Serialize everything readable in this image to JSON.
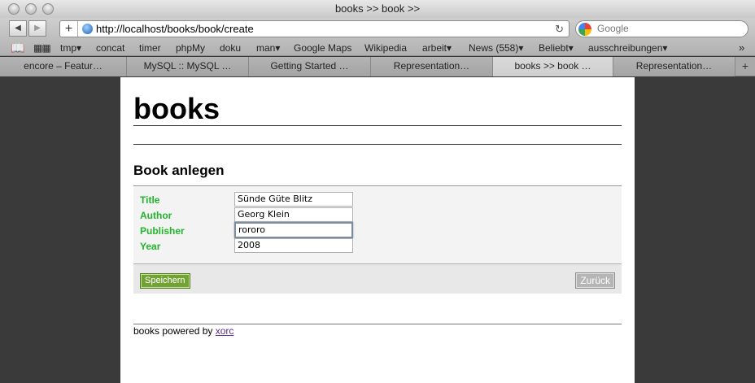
{
  "window": {
    "title": "books >> book >>"
  },
  "toolbar": {
    "back_icon": "back-arrow-icon",
    "forward_icon": "forward-arrow-icon",
    "add_icon": "plus-icon",
    "url": "http://localhost/books/book/create",
    "search_placeholder": "Google"
  },
  "bookmarks": {
    "items": [
      {
        "label": "tmp",
        "dropdown": true
      },
      {
        "label": "concat",
        "dropdown": false
      },
      {
        "label": "timer",
        "dropdown": false
      },
      {
        "label": "phpMy",
        "dropdown": false
      },
      {
        "label": "doku",
        "dropdown": false
      },
      {
        "label": "man",
        "dropdown": true
      },
      {
        "label": "Google Maps",
        "dropdown": false
      },
      {
        "label": "Wikipedia",
        "dropdown": false
      },
      {
        "label": "arbeit",
        "dropdown": true
      },
      {
        "label": "News (558)",
        "dropdown": true
      },
      {
        "label": "Beliebt",
        "dropdown": true
      },
      {
        "label": "ausschreibungen",
        "dropdown": true
      }
    ],
    "overflow": "»"
  },
  "tabs": [
    {
      "label": "encore – Featur…",
      "active": false
    },
    {
      "label": "MySQL :: MySQL …",
      "active": false
    },
    {
      "label": "Getting Started …",
      "active": false
    },
    {
      "label": "Representation…",
      "active": false
    },
    {
      "label": "books >> book …",
      "active": true
    },
    {
      "label": "Representation…",
      "active": false
    }
  ],
  "page": {
    "site_title": "books",
    "form_title": "Book anlegen",
    "fields": [
      {
        "label": "Title",
        "value": "Sünde Güte Blitz"
      },
      {
        "label": "Author",
        "value": "Georg Klein"
      },
      {
        "label": "Publisher",
        "value": "rororo"
      },
      {
        "label": "Year",
        "value": "2008"
      }
    ],
    "save_label": "Speichern",
    "back_label": "Zurück",
    "footer_text": "books powered by ",
    "footer_link": "xorc"
  },
  "colors": {
    "label_green": "#22b52c",
    "save_button": "#72a234",
    "link": "#5a2d91",
    "side_background": "#3a3a3a"
  }
}
